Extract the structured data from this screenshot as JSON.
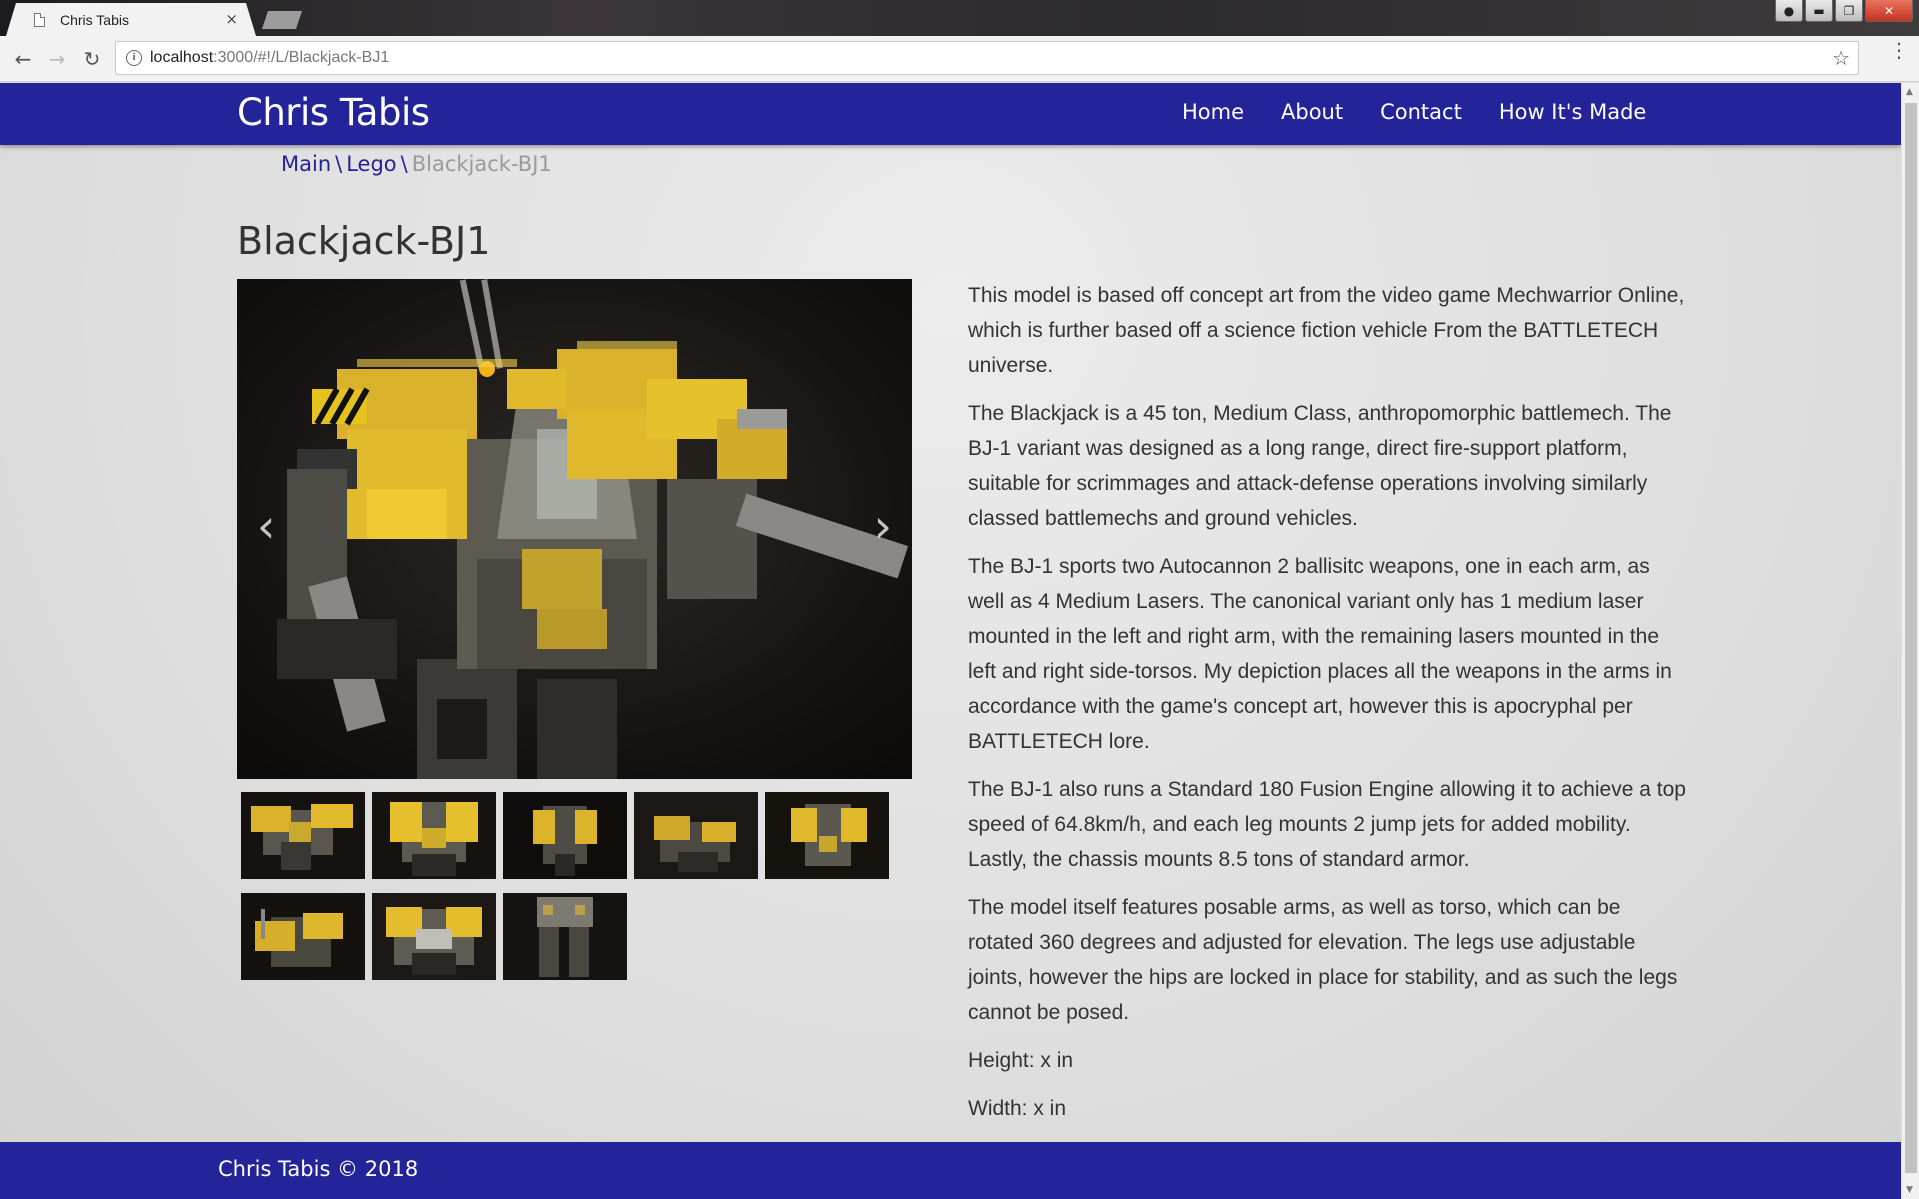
{
  "browser": {
    "tab_title": "Chris Tabis",
    "tab_close": "×",
    "url_host": "localhost",
    "url_path": ":3000/#!/L/Blackjack-BJ1"
  },
  "site": {
    "brand": "Chris Tabis",
    "nav": [
      "Home",
      "About",
      "Contact",
      "How It's Made"
    ]
  },
  "breadcrumb": {
    "items": [
      "Main",
      "Lego"
    ],
    "separator": "\\",
    "current": "Blackjack-BJ1"
  },
  "page": {
    "title": "Blackjack-BJ1",
    "carousel": {
      "prev": "‹",
      "next": "›"
    },
    "thumbnail_count": 8,
    "paragraphs": [
      "This model is based off concept art from the video game Mechwarrior Online, which is further based off a science fiction vehicle From the BATTLETECH universe.",
      "The Blackjack is a 45 ton, Medium Class, anthropomorphic battlemech. The BJ-1 variant was designed as a long range, direct fire-support platform, suitable for scrimmages and attack-defense operations involving similarly classed battlemechs and ground vehicles.",
      "The BJ-1 sports two Autocannon 2 ballisitc weapons, one in each arm, as well as 4 Medium Lasers. The canonical variant only has 1 medium laser mounted in the left and right arm, with the remaining lasers mounted in the left and right side-torsos. My depiction places all the weapons in the arms in accordance with the game's concept art, however this is apocryphal per BATTLETECH lore.",
      "The BJ-1 also runs a Standard 180 Fusion Engine allowing it to achieve a top speed of 64.8km/h, and each leg mounts 2 jump jets for added mobility. Lastly, the chassis mounts 8.5 tons of standard armor.",
      "The model itself features posable arms, as well as torso, which can be rotated 360 degrees and adjusted for elevation. The legs use adjustable joints, however the hips are locked in place for stability, and as such the legs cannot be posed.",
      "Height: x in",
      "Width: x in"
    ]
  },
  "footer": {
    "text": "Chris Tabis © 2018"
  },
  "colors": {
    "navbar": "#23239a",
    "lego_yellow": "#e6b82a",
    "page_bg": "#dcdcdc"
  }
}
